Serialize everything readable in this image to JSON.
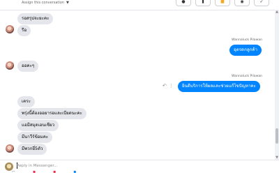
{
  "header": {
    "assign_label": "Assign this conversation",
    "actions": [
      {
        "icon": "info-icon",
        "glyph": "ℹ"
      },
      {
        "icon": "trash-icon",
        "glyph": "🗑"
      },
      {
        "icon": "label-icon",
        "glyph": "■"
      },
      {
        "icon": "mail-icon",
        "glyph": "✉"
      },
      {
        "icon": "checkmark-icon",
        "glyph": "✓"
      }
    ]
  },
  "messages": [
    {
      "dir": "in",
      "text": "รอสรุปจะยะคะ"
    },
    {
      "dir": "in",
      "text": "รือ"
    },
    {
      "dir": "out",
      "sender": "Wannaluck Pilawan",
      "text": "อุตรดกลูกค้า"
    },
    {
      "dir": "in",
      "text": "ออคะๆ"
    },
    {
      "dir": "out",
      "sender": "Wannaluck Pilawan",
      "text": "ยินดีบริการให้ผลและช่วยแก้ไขปัญหาคะ"
    },
    {
      "dir": "in",
      "text": "เคระ"
    },
    {
      "dir": "in",
      "text": "พรุ่งนี้ต้องออยารอและเบียดนะคะ"
    },
    {
      "dir": "in",
      "text": "แอมีสมุดเอนเชียว"
    },
    {
      "dir": "in",
      "text": "มีนาวีร์ข้อมคะ"
    },
    {
      "dir": "in",
      "text": "มีพวกยี่5ตัว"
    }
  ],
  "composer": {
    "placeholder": "Reply in Messenger...",
    "icons": [
      "attach-icon",
      "gif-icon",
      "emoji-icon",
      "thumbs-up-icon"
    ]
  }
}
